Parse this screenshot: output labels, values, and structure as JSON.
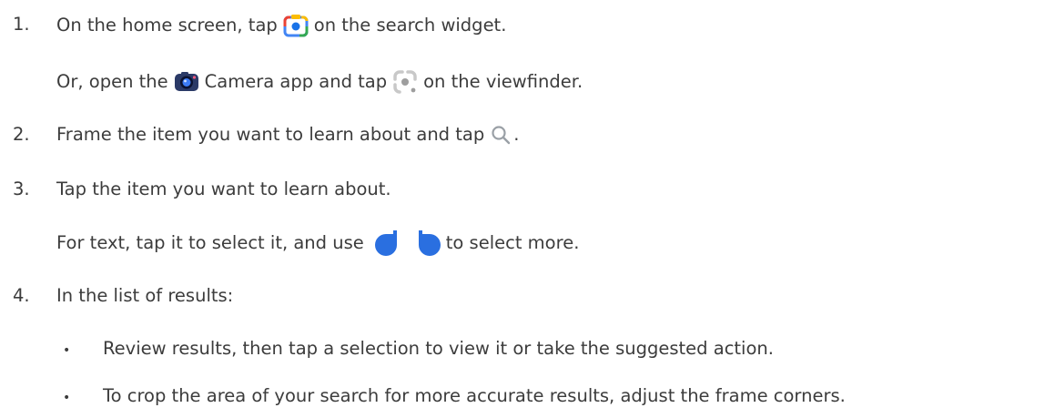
{
  "steps": [
    {
      "number": "1.",
      "parts": [
        "On the home screen, tap",
        "on the search widget."
      ]
    },
    {
      "sub": [
        "Or, open the",
        "Camera app and tap",
        "on the viewfinder."
      ]
    },
    {
      "number": "2.",
      "parts": [
        "Frame the item you want to learn about and tap",
        "."
      ]
    },
    {
      "number": "3.",
      "text": "Tap the item you want to learn about."
    },
    {
      "sub": [
        "For text, tap it to select it, and use",
        "to select more."
      ]
    },
    {
      "number": "4.",
      "text": "In the list of results:"
    }
  ],
  "bullets": [
    "Review results, then tap a selection to view it or take the suggested action.",
    "To crop the area of your search for more accurate results, adjust the frame corners."
  ],
  "bullet_glyph": "•",
  "icons": {
    "lens_widget": "google-lens-widget-icon",
    "camera_app": "camera-app-icon",
    "lens_viewfinder": "lens-viewfinder-icon",
    "search": "search-magnifier-icon",
    "selection_handles": "text-selection-handle-icon"
  },
  "colors": {
    "text": "#3c3c3c",
    "accent_blue": "#1a73e8",
    "handle_blue": "#2a6fe0"
  }
}
